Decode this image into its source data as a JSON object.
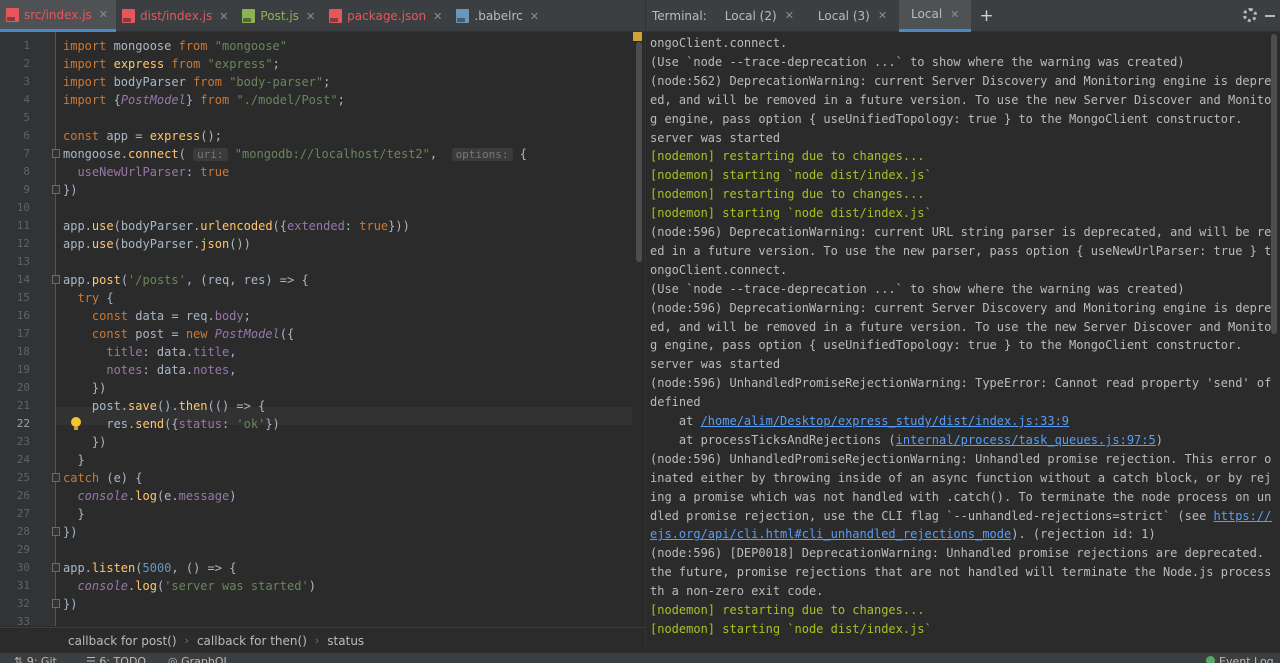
{
  "editor": {
    "tabs": [
      {
        "label": "src/index.js",
        "active": true,
        "color": "#e5565d",
        "icon": "js-file-icon"
      },
      {
        "label": "dist/index.js",
        "active": false,
        "color": "#e5565d",
        "icon": "js-file-icon"
      },
      {
        "label": "Post.js",
        "active": false,
        "color": "#8bb255",
        "icon": "js-file-icon"
      },
      {
        "label": "package.json",
        "active": false,
        "color": "#e5565d",
        "icon": "json-file-icon"
      },
      {
        "label": ".babelrc",
        "active": false,
        "color": "#6897bb",
        "icon": "babelrc-file-icon"
      }
    ],
    "current_line": 22,
    "hints": {
      "uri": "uri:",
      "options": "options:"
    },
    "breadcrumb": [
      "callback for post()",
      "callback for then()",
      "status"
    ]
  },
  "terminal": {
    "title": "Terminal:",
    "tabs": [
      {
        "label": "Local (2)",
        "active": false
      },
      {
        "label": "Local (3)",
        "active": false
      },
      {
        "label": "Local",
        "active": true
      }
    ],
    "lines": [
      {
        "text": "ongoClient.connect."
      },
      {
        "text": "(Use `node --trace-deprecation ...` to show where the warning was created)"
      },
      {
        "text": "(node:562) DeprecationWarning: current Server Discovery and Monitoring engine is deprecat"
      },
      {
        "text": "ed, and will be removed in a future version. To use the new Server Discover and Monitorin"
      },
      {
        "text": "g engine, pass option { useUnifiedTopology: true } to the MongoClient constructor."
      },
      {
        "text": "server was started"
      },
      {
        "text": "[nodemon] restarting due to changes...",
        "nodemon": true
      },
      {
        "text": "[nodemon] starting `node dist/index.js`",
        "nodemon": true
      },
      {
        "text": "[nodemon] restarting due to changes...",
        "nodemon": true
      },
      {
        "text": "[nodemon] starting `node dist/index.js`",
        "nodemon": true
      },
      {
        "text": "(node:596) DeprecationWarning: current URL string parser is deprecated, and will be remov"
      },
      {
        "text": "ed in a future version. To use the new parser, pass option { useNewUrlParser: true } to M"
      },
      {
        "text": "ongoClient.connect."
      },
      {
        "text": "(Use `node --trace-deprecation ...` to show where the warning was created)"
      },
      {
        "text": "(node:596) DeprecationWarning: current Server Discovery and Monitoring engine is deprecat"
      },
      {
        "text": "ed, and will be removed in a future version. To use the new Server Discover and Monitorin"
      },
      {
        "text": "g engine, pass option { useUnifiedTopology: true } to the MongoClient constructor."
      },
      {
        "text": "server was started"
      },
      {
        "text": "(node:596) UnhandledPromiseRejectionWarning: TypeError: Cannot read property 'send' of un"
      },
      {
        "text": "defined"
      },
      {
        "text": "    at ",
        "link": "/home/alim/Desktop/express_study/dist/index.js:33:9",
        "after": ""
      },
      {
        "text": "    at processTicksAndRejections (",
        "link": "internal/process/task_queues.js:97:5",
        "after": ")"
      },
      {
        "text": "(node:596) UnhandledPromiseRejectionWarning: Unhandled promise rejection. This error orig"
      },
      {
        "text": "inated either by throwing inside of an async function without a catch block, or by reject"
      },
      {
        "text": "ing a promise which was not handled with .catch(). To terminate the node process on unhan"
      },
      {
        "text": "dled promise rejection, use the CLI flag `--unhandled-rejections=strict` (see ",
        "link": "https://nod",
        "after": ""
      },
      {
        "text": "",
        "link": "ejs.org/api/cli.html#cli_unhandled_rejections_mode",
        "after": "). (rejection id: 1)"
      },
      {
        "text": "(node:596) [DEP0018] DeprecationWarning: Unhandled promise rejections are deprecated. In"
      },
      {
        "text": "the future, promise rejections that are not handled will terminate the Node.js process wi"
      },
      {
        "text": "th a non-zero exit code."
      },
      {
        "text": "[nodemon] restarting due to changes...",
        "nodemon": true
      },
      {
        "text": "[nodemon] starting `node dist/index.js`",
        "nodemon": true
      }
    ]
  },
  "statusbar": {
    "git": "9: Git",
    "todo": "6: TODO",
    "graphql": "GraphQL",
    "event_log": "Event Log"
  },
  "colors": {
    "accent": "#4a88c7",
    "nodemon": "#a8c023",
    "link": "#589df6"
  }
}
